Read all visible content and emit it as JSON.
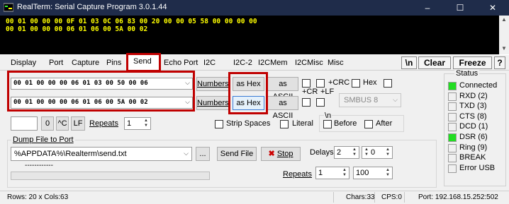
{
  "window": {
    "title": "RealTerm: Serial Capture Program 3.0.1.44",
    "minimize": "–",
    "maximize": "☐",
    "close": "✕"
  },
  "terminal": {
    "lines": [
      "00 01 00 00 00 0F 01 03 0C 06 83 00 20 00 00 05 58 00 00 00 00",
      "00 01 00 00 00 06 01 06 00 5A 00 02"
    ]
  },
  "tabs": {
    "display": "Display",
    "port": "Port",
    "capture": "Capture",
    "pins": "Pins",
    "send": "Send",
    "echo_port": "Echo Port",
    "i2c": "I2C",
    "i2c2": "I2C-2",
    "i2cmem": "I2CMem",
    "i2cmisc": "I2CMisc",
    "misc": "Misc"
  },
  "top_buttons": {
    "newline": "\\n",
    "clear": "Clear",
    "freeze": "Freeze",
    "help": "?"
  },
  "send": {
    "line1_value": "00 01 00 00 00 06 01 03 00 50 00 06",
    "line2_value": "00 01 00 00 00 06 01 06 00 5A 00 02",
    "numbers_label": "Numbers",
    "as_hex_label": "as Hex",
    "as_ascii_label": "as ASCII",
    "crc_label": "+CRC",
    "hex_label": "Hex",
    "cr_label": "+CR",
    "lf_label": "+LF",
    "crc_type": "SMBUS 8",
    "zero_label": "0",
    "ctrl_c_label": "^C",
    "lf_btn_label": "LF",
    "repeats_label": "Repeats",
    "repeats_value": "1",
    "strip_spaces_label": "Strip Spaces",
    "literal_label": "Literal",
    "newline_group_label": "\\n",
    "before_label": "Before",
    "after_label": "After"
  },
  "dump": {
    "group_label": "Dump File to Port",
    "file_path": "%APPDATA%\\Realterm\\send.txt",
    "browse_label": "...",
    "send_file_label": "Send File",
    "stop_label": "Stop",
    "delays_label": "Delays",
    "delay1_value": "2",
    "delay2_value": "0",
    "repeats_label": "Repeats",
    "repeats_value": "1",
    "count_value": "100",
    "progress_placeholder": "------------"
  },
  "status": {
    "title": "Status",
    "items": [
      {
        "label": "Connected",
        "on": true
      },
      {
        "label": "RXD (2)",
        "on": false
      },
      {
        "label": "TXD (3)",
        "on": false
      },
      {
        "label": "CTS (8)",
        "on": false
      },
      {
        "label": "DCD (1)",
        "on": false
      },
      {
        "label": "DSR (6)",
        "on": true
      },
      {
        "label": "Ring (9)",
        "on": false
      },
      {
        "label": "BREAK",
        "on": false
      },
      {
        "label": "Error USB",
        "on": false
      }
    ],
    "led_on_color": "#22dd22",
    "led_off_color": "#f0f0f0"
  },
  "statusbar": {
    "rows_cols": "Rows: 20 x Cols:63",
    "chars": "Chars:33",
    "cps": "CPS:0",
    "port": "Port: 192.168.15.252:502"
  },
  "colors": {
    "highlight_red": "#c00000",
    "terminal_text": "#ffff00",
    "titlebar_bg": "#1f2c4a"
  }
}
